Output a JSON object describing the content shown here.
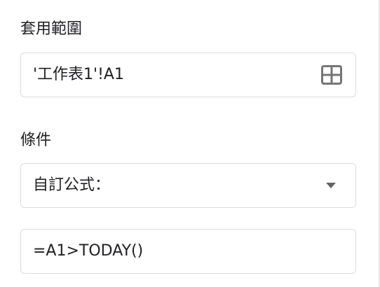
{
  "range_section": {
    "label": "套用範圍",
    "value": "'工作表1'!A1",
    "icon": "grid-icon"
  },
  "condition_section": {
    "label": "條件",
    "selected_option": "自訂公式：",
    "icon": "chevron-down-icon",
    "formula_value": "=A1>TODAY()"
  }
}
